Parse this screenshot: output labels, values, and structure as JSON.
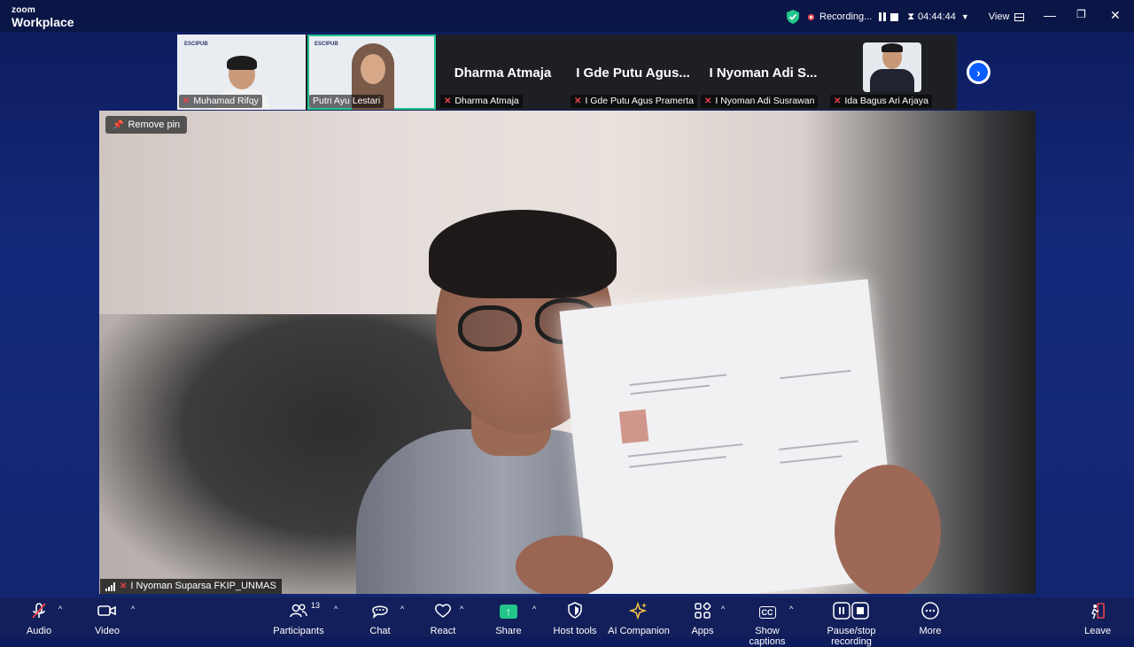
{
  "app": {
    "brand_small": "zoom",
    "brand_big": "Workplace"
  },
  "titlebar": {
    "recording": "Recording...",
    "timer": "04:44:44",
    "view": "View",
    "minimize": "—",
    "restore": "❐",
    "close": "✕"
  },
  "thumbnails": [
    {
      "name": "Muhamad Rifqy",
      "video": true,
      "brand": "ESCIPUB"
    },
    {
      "name": "Putri Ayu Lestari",
      "video": true,
      "brand": "ESCIPUB",
      "active": true
    },
    {
      "name": "Dharma Atmaja",
      "display": "Dharma Atmaja"
    },
    {
      "name": "I Gde Putu Agus Pramerta",
      "display": "I Gde Putu Agus..."
    },
    {
      "name": "I Nyoman Adi Susrawan",
      "display": "I Nyoman Adi S..."
    },
    {
      "name": "Ida Bagus Ari Arjaya",
      "video": true
    }
  ],
  "main": {
    "remove_pin": "Remove pin",
    "speaker": "I Nyoman Suparsa FKIP_UNMAS"
  },
  "toolbar": {
    "audio": "Audio",
    "video": "Video",
    "participants": "Participants",
    "participant_count": "13",
    "chat": "Chat",
    "react": "React",
    "share": "Share",
    "host_tools": "Host tools",
    "ai_companion": "AI Companion",
    "apps": "Apps",
    "show_captions": "Show captions",
    "captions_icon": "CC",
    "pause_stop_recording": "Pause/stop recording",
    "more": "More",
    "leave": "Leave"
  }
}
